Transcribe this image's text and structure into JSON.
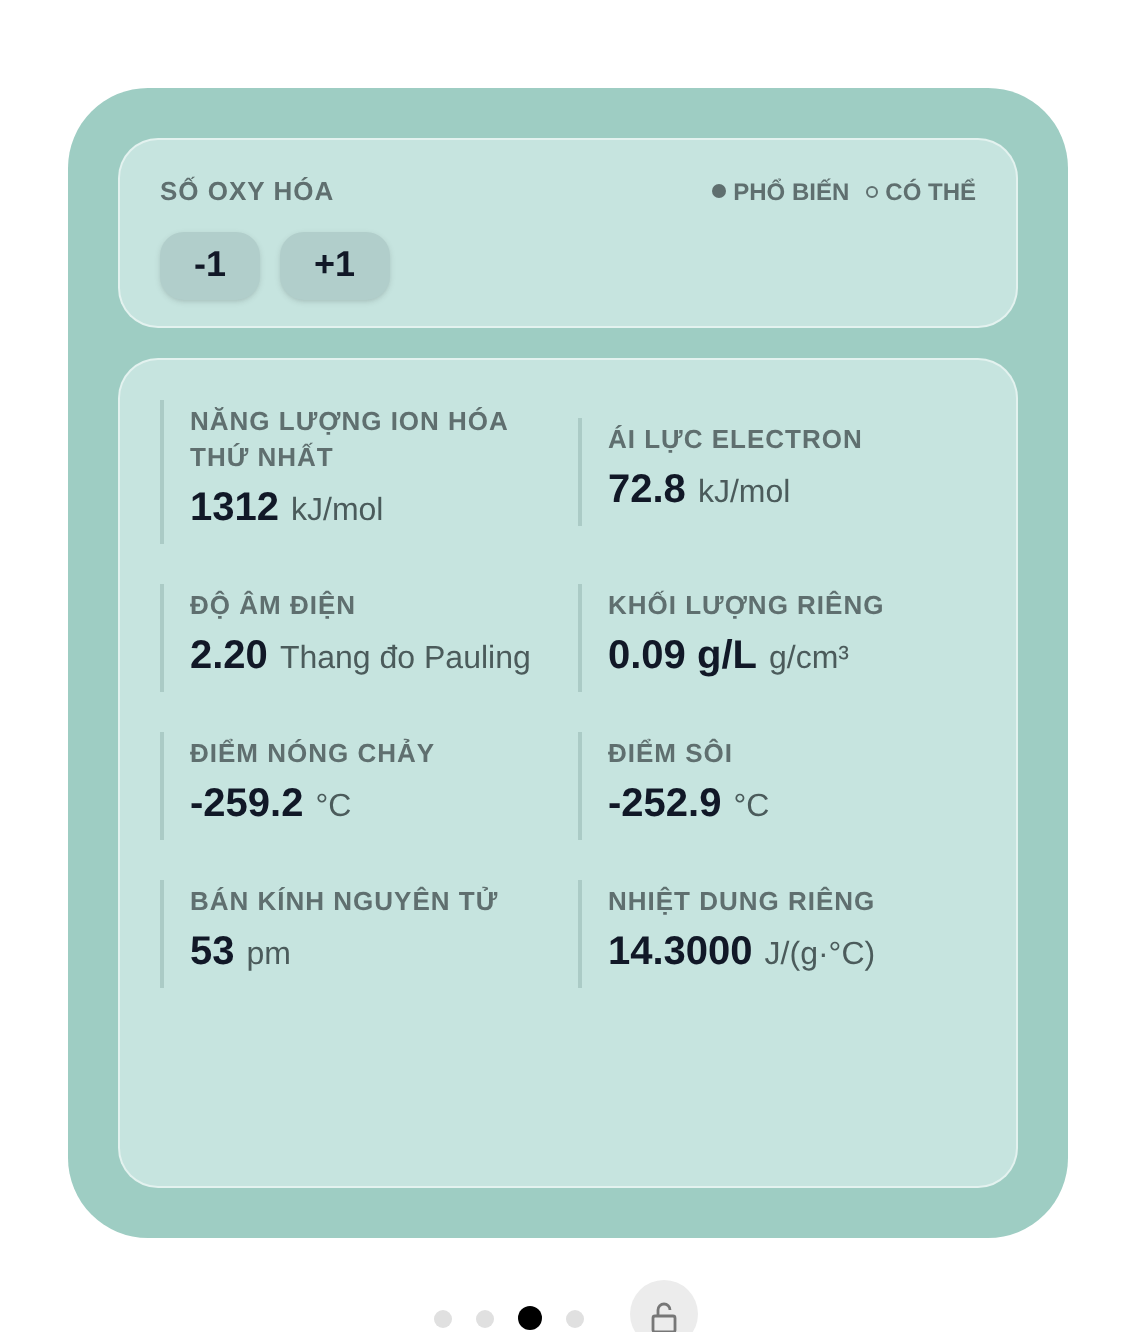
{
  "oxidation": {
    "title": "SỐ OXY HÓA",
    "legend": [
      {
        "kind": "filled",
        "label": "PHỔ BIẾN"
      },
      {
        "kind": "hollow",
        "label": "CÓ THỂ"
      }
    ],
    "states": [
      "-1",
      "+1"
    ]
  },
  "properties": [
    {
      "label": "NĂNG LƯỢNG ION HÓA THỨ NHẤT",
      "value": "1312",
      "unit": "kJ/mol"
    },
    {
      "label": "ÁI LỰC ELECTRON",
      "value": "72.8",
      "unit": "kJ/mol"
    },
    {
      "label": "ĐỘ ÂM ĐIỆN",
      "value": "2.20",
      "unit": "Thang đo Pauling"
    },
    {
      "label": "KHỐI LƯỢNG RIÊNG",
      "value": "0.09 g/L",
      "unit": "g/cm³"
    },
    {
      "label": "ĐIỂM NÓNG CHẢY",
      "value": "-259.2",
      "unit": "°C"
    },
    {
      "label": "ĐIỂM SÔI",
      "value": "-252.9",
      "unit": "°C"
    },
    {
      "label": "BÁN KÍNH NGUYÊN TỬ",
      "value": "53",
      "unit": "pm"
    },
    {
      "label": "NHIỆT DUNG RIÊNG",
      "value": "14.3000",
      "unit": "J/(g·°C)"
    }
  ],
  "pagination": [
    {
      "selected": false
    },
    {
      "selected": false
    },
    {
      "selected": true
    },
    {
      "selected": false
    }
  ]
}
